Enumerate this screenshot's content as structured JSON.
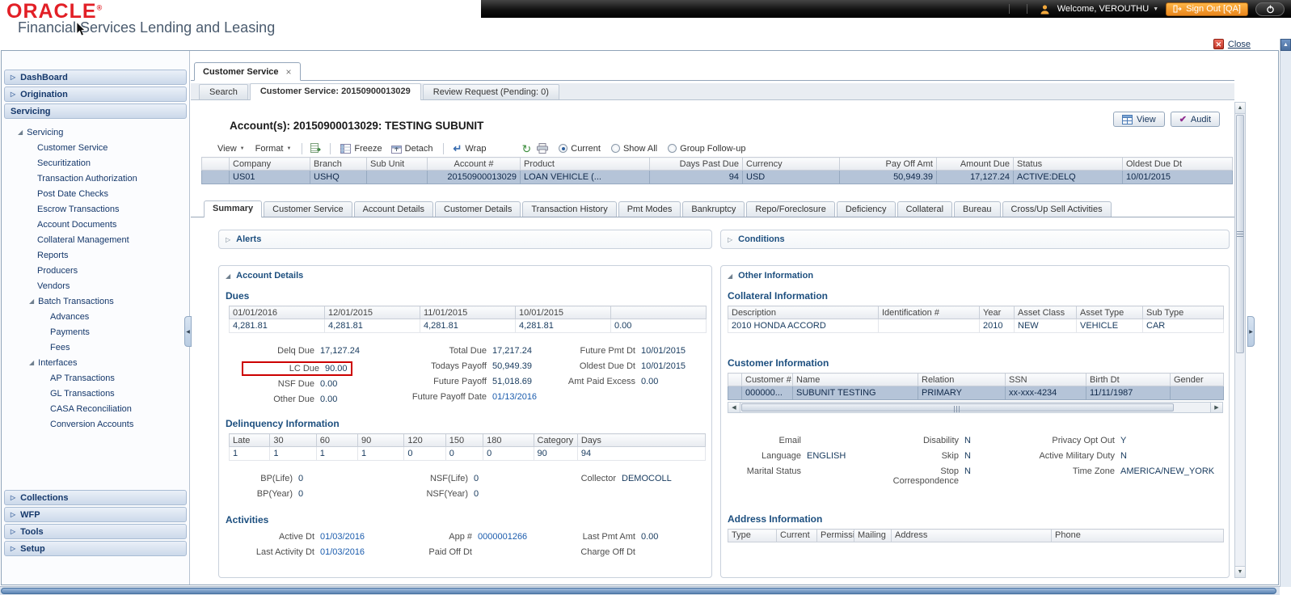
{
  "header": {
    "brand": "ORACLE",
    "registered": "®",
    "product": "Financial Services Lending and Leasing",
    "topbar": {
      "welcome": "Welcome, VEROUTHU",
      "sign_out": "Sign Out [QA]"
    }
  },
  "window": {
    "tab": "Customer Service",
    "close": "Close"
  },
  "sidebar": {
    "sections_top": [
      "DashBoard",
      "Origination"
    ],
    "servicing_section": "Servicing",
    "tree": {
      "root": "Servicing",
      "items": [
        "Customer Service",
        "Securitization",
        "Transaction Authorization",
        "Post Date Checks",
        "Escrow Transactions",
        "Account Documents",
        "Collateral Management",
        "Reports",
        "Producers",
        "Vendors"
      ],
      "batch_label": "Batch Transactions",
      "batch_items": [
        "Advances",
        "Payments",
        "Fees"
      ],
      "interfaces_label": "Interfaces",
      "interfaces_items": [
        "AP Transactions",
        "GL Transactions",
        "CASA Reconciliation",
        "Conversion Accounts"
      ]
    },
    "sections_bottom": [
      "Collections",
      "WFP",
      "Tools",
      "Setup"
    ]
  },
  "subtabs": {
    "search": "Search",
    "current": "Customer Service: 20150900013029",
    "review": "Review Request (Pending: 0)"
  },
  "account_header": {
    "title": "Account(s): 20150900013029: TESTING SUBUNIT",
    "view": "View",
    "audit": "Audit"
  },
  "toolbar": {
    "view": "View",
    "format": "Format",
    "freeze": "Freeze",
    "detach": "Detach",
    "wrap": "Wrap",
    "radio_current": "Current",
    "radio_show_all": "Show All",
    "radio_group_followup": "Group Follow-up"
  },
  "accounts_grid": {
    "columns": [
      "Company",
      "Branch",
      "Sub Unit",
      "Account #",
      "Product",
      "Days Past Due",
      "Currency",
      "Pay Off Amt",
      "Amount Due",
      "Status",
      "Oldest Due Dt"
    ],
    "row": [
      "US01",
      "USHQ",
      "",
      "20150900013029",
      "LOAN VEHICLE (...",
      "94",
      "USD",
      "50,949.39",
      "17,127.24",
      "ACTIVE:DELQ",
      "10/01/2015"
    ]
  },
  "detail_tabs": [
    "Summary",
    "Customer Service",
    "Account Details",
    "Customer Details",
    "Transaction History",
    "Pmt Modes",
    "Bankruptcy",
    "Repo/Foreclosure",
    "Deficiency",
    "Collateral",
    "Bureau",
    "Cross/Up Sell Activities"
  ],
  "alerts": {
    "title": "Alerts"
  },
  "conditions": {
    "title": "Conditions"
  },
  "account_details": {
    "title": "Account Details",
    "dues_heading": "Dues",
    "dues_columns": [
      "01/01/2016",
      "12/01/2015",
      "11/01/2015",
      "10/01/2015",
      ""
    ],
    "dues_values": [
      "4,281.81",
      "4,281.81",
      "4,281.81",
      "4,281.81",
      "0.00"
    ],
    "f": {
      "delq_due": {
        "label": "Delq Due",
        "value": "17,127.24"
      },
      "lc_due": {
        "label": "LC Due",
        "value": "90.00"
      },
      "nsf_due": {
        "label": "NSF Due",
        "value": "0.00"
      },
      "other_due": {
        "label": "Other Due",
        "value": "0.00"
      },
      "total_due": {
        "label": "Total Due",
        "value": "17,217.24"
      },
      "todays_payoff": {
        "label": "Todays Payoff",
        "value": "50,949.39"
      },
      "future_payoff": {
        "label": "Future Payoff",
        "value": "51,018.69"
      },
      "future_payoff_date": {
        "label": "Future Payoff Date",
        "value": "01/13/2016"
      },
      "future_pmt_dt": {
        "label": "Future Pmt Dt",
        "value": "10/01/2015"
      },
      "oldest_due_dt": {
        "label": "Oldest Due Dt",
        "value": "10/01/2015"
      },
      "amt_paid_excess": {
        "label": "Amt Paid Excess",
        "value": "0.00"
      }
    },
    "delinquency_heading": "Delinquency Information",
    "delinquency_columns": [
      "Late",
      "30",
      "60",
      "90",
      "120",
      "150",
      "180",
      "Category",
      "Days"
    ],
    "delinquency_values": [
      "1",
      "1",
      "1",
      "1",
      "0",
      "0",
      "0",
      "90",
      "94"
    ],
    "c": {
      "bp_life": {
        "label": "BP(Life)",
        "value": "0"
      },
      "bp_year": {
        "label": "BP(Year)",
        "value": "0"
      },
      "nsf_life": {
        "label": "NSF(Life)",
        "value": "0"
      },
      "nsf_year": {
        "label": "NSF(Year)",
        "value": "0"
      },
      "collector": {
        "label": "Collector",
        "value": "DEMOCOLL"
      }
    },
    "activities_heading": "Activities",
    "a": {
      "active_dt": {
        "label": "Active Dt",
        "value": "01/03/2016"
      },
      "last_activity_dt": {
        "label": "Last Activity Dt",
        "value": "01/03/2016"
      },
      "app_no": {
        "label": "App #",
        "value": "0000001266"
      },
      "paid_off_dt": {
        "label": "Paid Off Dt",
        "value": ""
      },
      "last_pmt_amt": {
        "label": "Last Pmt Amt",
        "value": "0.00"
      },
      "charge_off_dt": {
        "label": "Charge Off Dt",
        "value": ""
      }
    }
  },
  "other_information": {
    "title": "Other Information",
    "collateral_heading": "Collateral Information",
    "collateral_columns": [
      "Description",
      "Identification #",
      "Year",
      "Asset Class",
      "Asset Type",
      "Sub Type"
    ],
    "collateral_row": [
      "2010 HONDA ACCORD",
      "",
      "2010",
      "NEW",
      "VEHICLE",
      "CAR"
    ],
    "customer_heading": "Customer Information",
    "customer_columns": [
      "Customer #",
      "Name",
      "Relation",
      "SSN",
      "Birth Dt",
      "Gender"
    ],
    "customer_row": [
      "000000...",
      "SUBUNIT TESTING",
      "PRIMARY",
      "xx-xxx-4234",
      "11/11/1987",
      ""
    ],
    "p": {
      "email": {
        "label": "Email",
        "value": ""
      },
      "language": {
        "label": "Language",
        "value": "ENGLISH"
      },
      "marital_status": {
        "label": "Marital Status",
        "value": ""
      },
      "disability": {
        "label": "Disability",
        "value": "N"
      },
      "skip": {
        "label": "Skip",
        "value": "N"
      },
      "stop_correspondence": {
        "label": "Stop Correspondence",
        "value": "N"
      },
      "privacy_opt_out": {
        "label": "Privacy Opt Out",
        "value": "Y"
      },
      "active_military_duty": {
        "label": "Active Military Duty",
        "value": "N"
      },
      "time_zone": {
        "label": "Time Zone",
        "value": "AMERICA/NEW_YORK"
      }
    },
    "address_heading": "Address Information",
    "address_columns": [
      "Type",
      "Current",
      "Permissio to Call",
      "Mailing",
      "Address",
      "Phone"
    ]
  },
  "icons": {
    "collapsed": "▷",
    "expanded": "◢",
    "caret_down": "▼",
    "tab_close": "×",
    "close_x": "✕",
    "audit_check": "✔",
    "refresh": "↻",
    "wrap": "↵",
    "scroll_up": "▲",
    "scroll_down": "▼",
    "scroll_left": "◀",
    "scroll_right": "▶"
  }
}
